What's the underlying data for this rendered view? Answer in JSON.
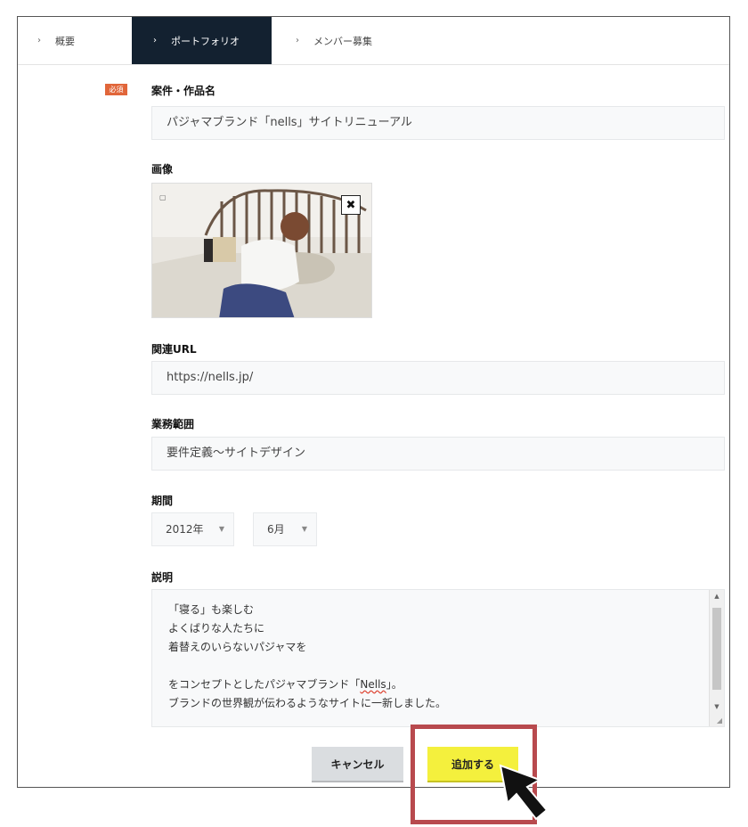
{
  "tabs": [
    {
      "label": "概要",
      "active": false
    },
    {
      "label": "ポートフォリオ",
      "active": true
    },
    {
      "label": "メンバー募集",
      "active": false
    }
  ],
  "form": {
    "required_badge": "必須",
    "project_name": {
      "label": "案件・作品名",
      "value": "パジャマブランド「nells」サイトリニューアル"
    },
    "image": {
      "label": "画像"
    },
    "url": {
      "label": "関連URL",
      "value": "https://nells.jp/"
    },
    "scope": {
      "label": "業務範囲",
      "value": "要件定義〜サイトデザイン"
    },
    "period": {
      "label": "期間",
      "year": "2012年",
      "month": "6月"
    },
    "description": {
      "label": "説明",
      "lines": [
        "「寝る」も楽しむ",
        "よくばりな人たちに",
        "着替えのいらないパジャマを",
        "",
        "をコンセプトとしたパジャマブランド「",
        "Nells",
        "」。",
        "ブランドの世界観が伝わるようなサイトに一新しました。"
      ]
    }
  },
  "buttons": {
    "cancel": "キャンセル",
    "add": "追加する"
  },
  "colors": {
    "active_tab": "#132130",
    "required": "#e1663a",
    "add_button": "#f4f03d",
    "highlight": "#b84a4e"
  }
}
